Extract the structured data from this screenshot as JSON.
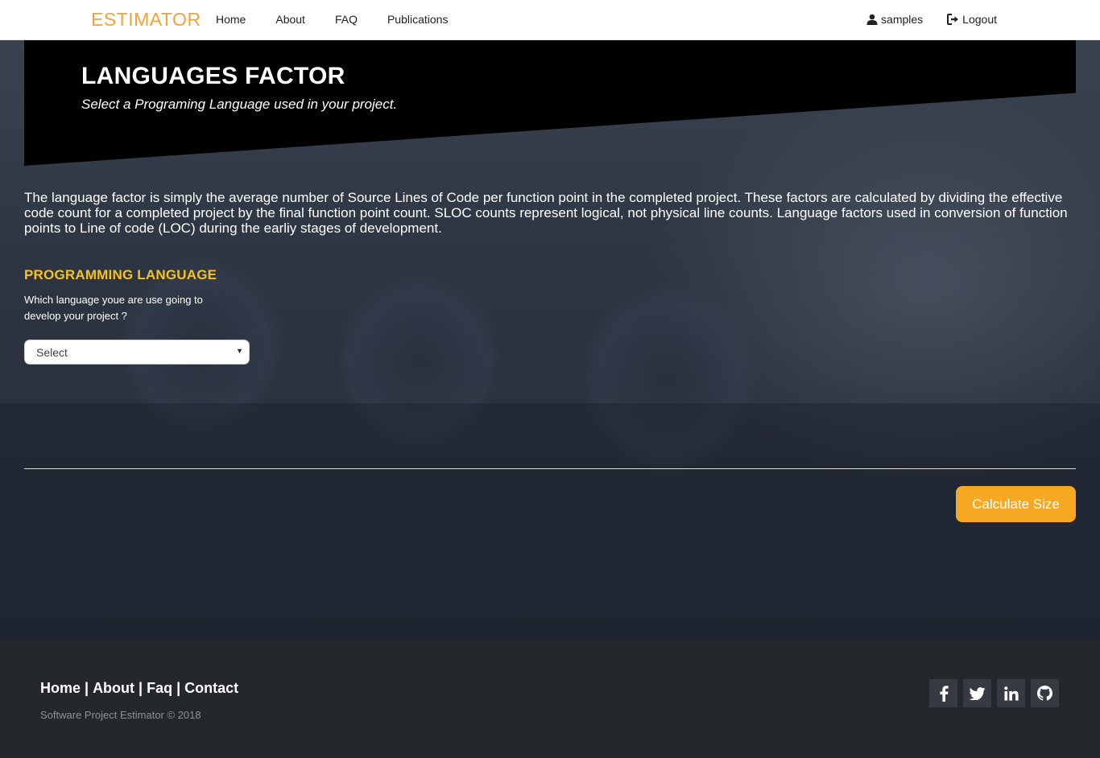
{
  "navbar": {
    "logo": "ESTIMATOR",
    "links": [
      "Home",
      "About",
      "FAQ",
      "Publications"
    ],
    "user_label": "samples",
    "logout_label": "Logout"
  },
  "banner": {
    "title": "LANGUAGES FACTOR",
    "subtitle": "Select a Programing Language used in your project."
  },
  "description": "The language factor is simply the average number of Source Lines of Code per function point in the completed project. These factors are calculated by dividing the effective code count for a completed project by the final function point count. SLOC counts represent logical, not physical line counts. Language factors used in conversion of function points to Line of code (LOC) during the earliy stages of development.",
  "form": {
    "section_title": "PROGRAMMING LANGUAGE",
    "question": "Which language youe are use going to develop your project ?",
    "select_value": "Select"
  },
  "actions": {
    "calculate_label": "Calculate Size"
  },
  "footer": {
    "links": [
      "Home",
      "About",
      "Faq",
      "Contact"
    ],
    "separator": "|",
    "copyright": "Software Project Estimator © 2018",
    "social_icons": [
      "facebook-icon",
      "twitter-icon",
      "linkedin-icon",
      "github-icon"
    ]
  },
  "colors": {
    "accent": "#f7a823",
    "section_title": "#f7c21c",
    "logo": "#f2a33a",
    "footer_bg": "#24282d"
  }
}
